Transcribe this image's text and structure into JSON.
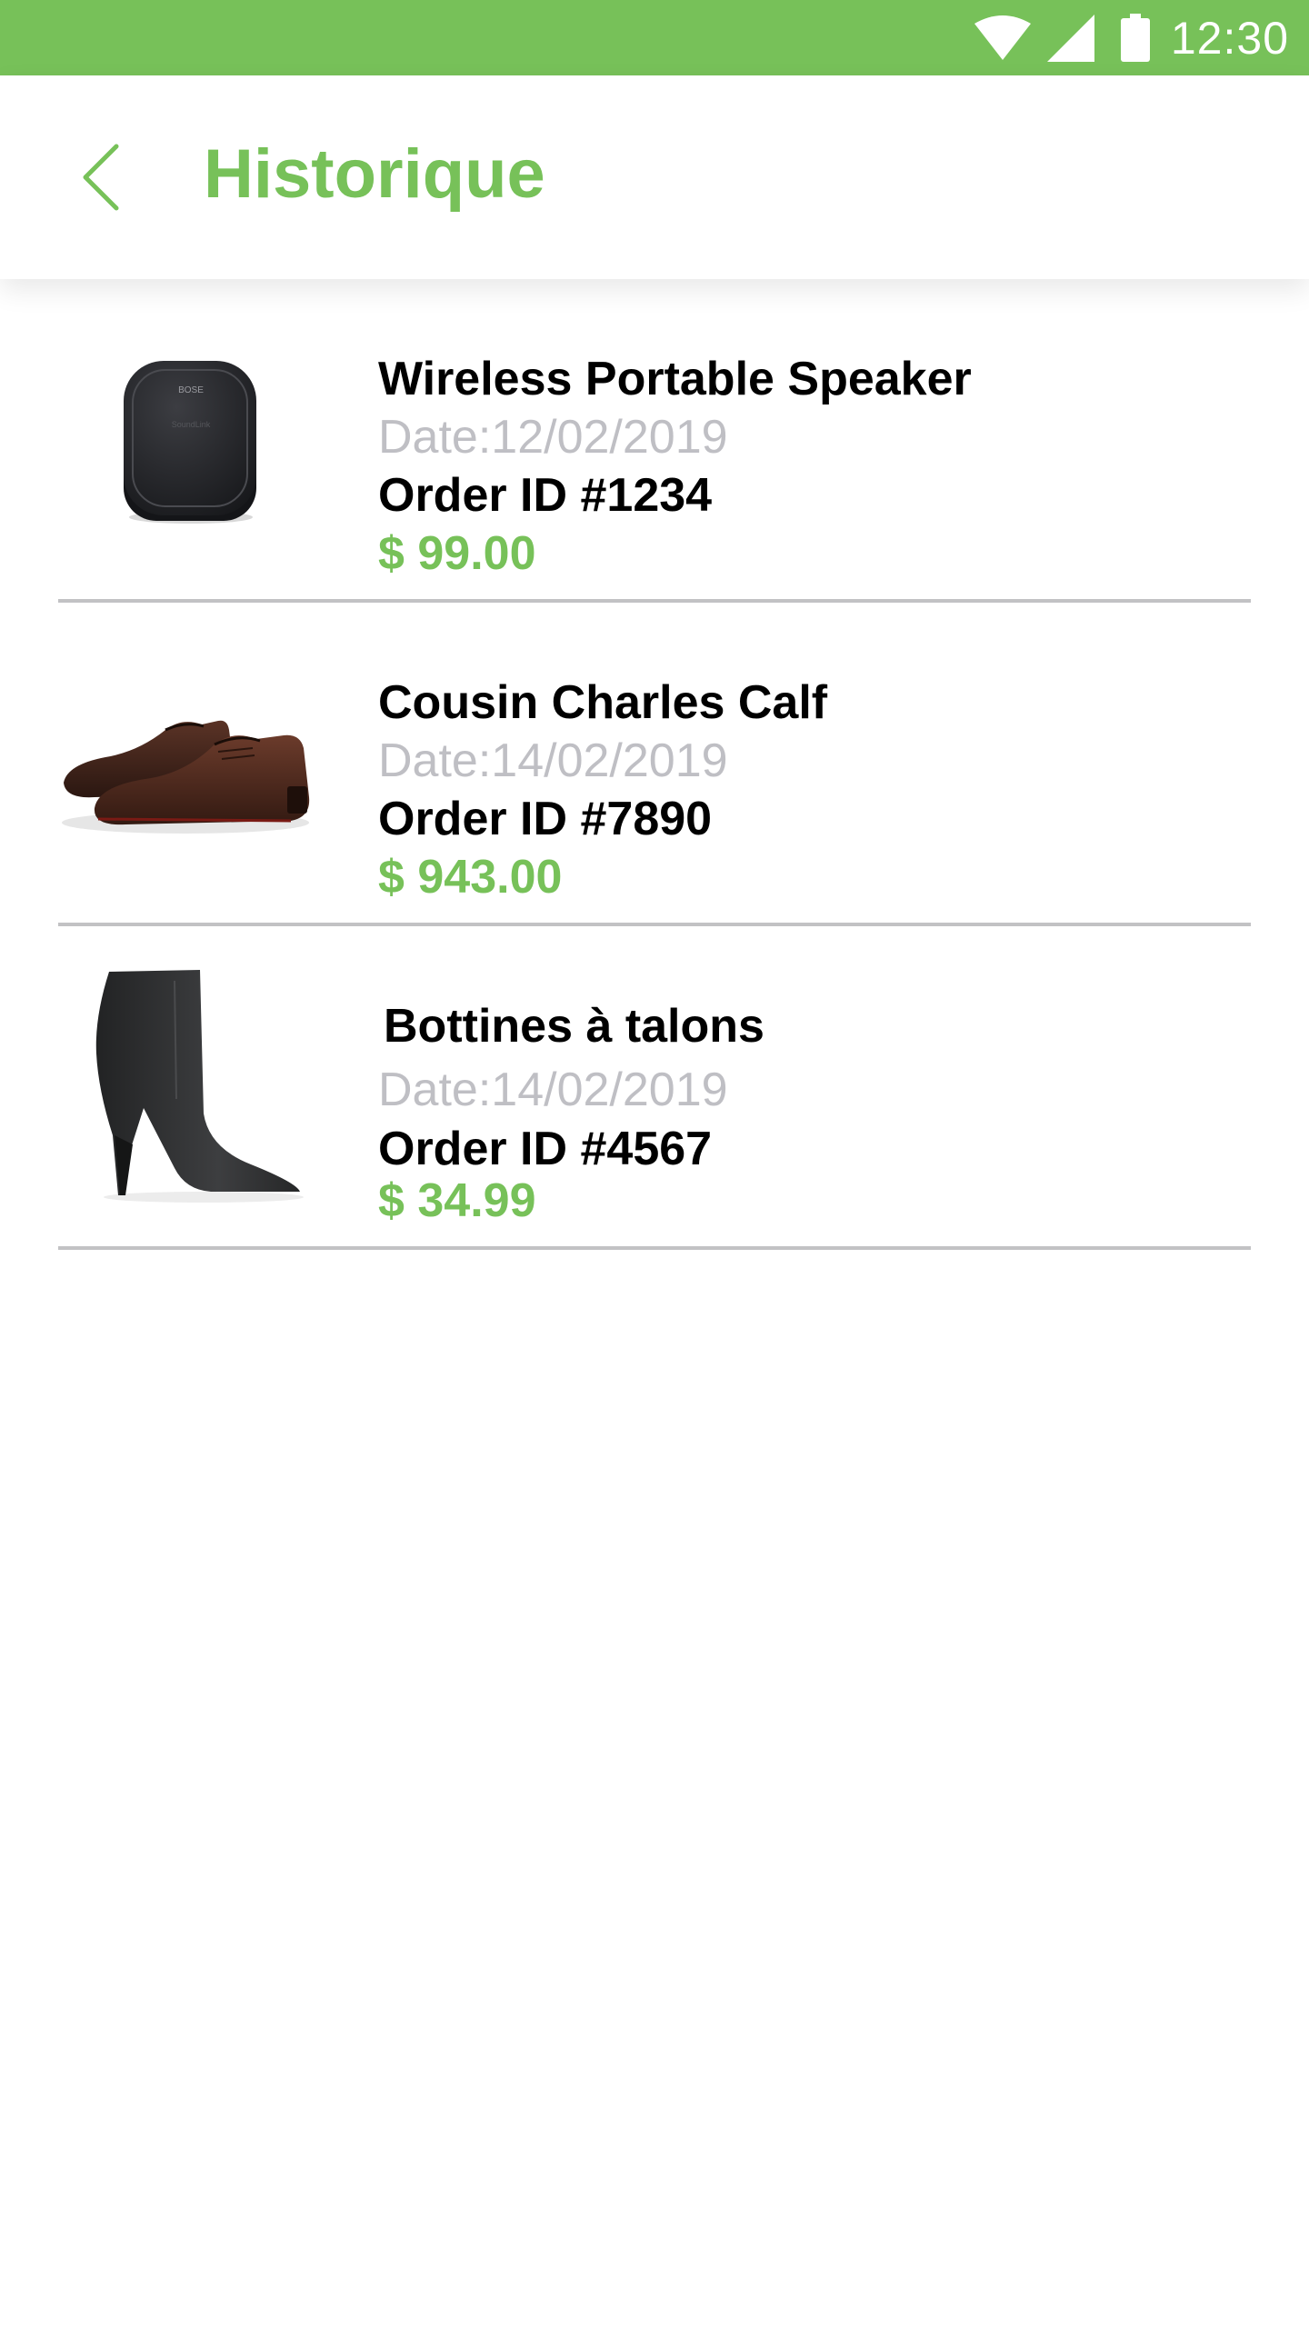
{
  "colors": {
    "accent": "#77c159",
    "divider": "#c2c2c4",
    "muted_text": "#bfbfc4",
    "text": "#000000"
  },
  "status_bar": {
    "time": "12:30",
    "icons": [
      "wifi-icon",
      "cell-signal-icon",
      "battery-icon"
    ]
  },
  "header": {
    "back_icon": "chevron-left-icon",
    "title": "Historique"
  },
  "orders": [
    {
      "name": "Wireless Portable Speaker",
      "date": "Date:12/02/2019",
      "order_id": "Order ID #1234",
      "price": "$ 99.00",
      "image": "speaker-thumbnail"
    },
    {
      "name": "Cousin Charles Calf",
      "date": "Date:14/02/2019",
      "order_id": "Order ID #7890",
      "price": "$ 943.00",
      "image": "dress-shoes-thumbnail"
    },
    {
      "name": "Bottines à talons",
      "date": "Date:14/02/2019",
      "order_id": "Order ID #4567",
      "price": "$ 34.99",
      "image": "heeled-boot-thumbnail"
    }
  ]
}
